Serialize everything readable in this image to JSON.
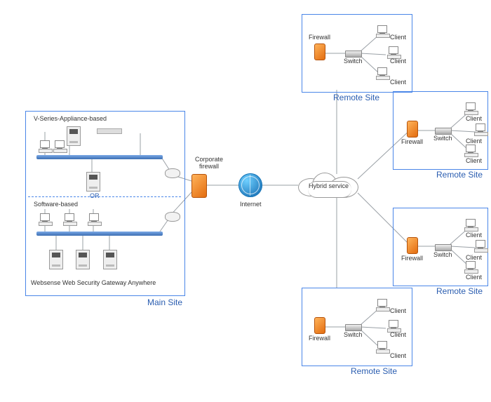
{
  "mainSite": {
    "label": "Main Site",
    "applianceHeading": "V-Series-Appliance-based",
    "softwareHeading": "Software-based",
    "orLabel": "OR",
    "productLabel": "Websense Web Security Gateway Anywhere"
  },
  "center": {
    "corporateFirewallLabel": "Corporate firewall",
    "internetLabel": "Internet",
    "hybridServiceLabel": "Hybrid service"
  },
  "remote": {
    "siteLabel": "Remote Site",
    "firewallLabel": "Firewall",
    "switchLabel": "Switch",
    "clientLabel": "Client"
  },
  "icons": {
    "firewall": "firewall-icon",
    "switch": "switch-icon",
    "server": "server-icon",
    "workstation": "workstation-icon",
    "router": "router-icon",
    "globe": "globe-icon",
    "cloud": "cloud-icon",
    "bus": "bus-icon",
    "rack": "rack-icon"
  }
}
